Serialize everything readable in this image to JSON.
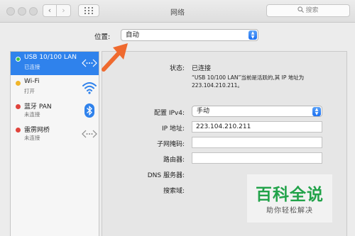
{
  "window": {
    "title": "网络",
    "search_placeholder": "搜索"
  },
  "location": {
    "label": "位置:",
    "value": "自动"
  },
  "services": [
    {
      "name": "USB 10/100 LAN",
      "status": "已连接",
      "dot_color": "#3cc04a",
      "icon": "ethernet-arrows-icon",
      "selected": true
    },
    {
      "name": "Wi-Fi",
      "status": "打开",
      "dot_color": "#f0b52a",
      "icon": "wifi-icon",
      "selected": false
    },
    {
      "name": "蓝牙 PAN",
      "status": "未连接",
      "dot_color": "#e0443c",
      "icon": "bluetooth-icon",
      "selected": false
    },
    {
      "name": "雷雳网桥",
      "status": "未连接",
      "dot_color": "#e0443c",
      "icon": "thunderbolt-arrows-icon",
      "selected": false
    }
  ],
  "detail": {
    "status_label": "状态:",
    "status_value": "已连接",
    "status_description": "“USB 10/100 LAN”当前是活跃的,其 IP 地址为 223.104.210.211。",
    "configure_label": "配置 IPv4:",
    "configure_value": "手动",
    "ip_label": "IP 地址:",
    "ip_value": "223.104.210.211",
    "subnet_label": "子网掩码:",
    "subnet_value": "",
    "router_label": "路由器:",
    "router_value": "",
    "dns_label": "DNS 服务器:",
    "search_domain_label": "搜索域:"
  },
  "watermark": {
    "title": "百科全说",
    "subtitle": "助你轻松解决"
  },
  "colors": {
    "accent": "#2f82ec",
    "annotation_arrow": "#ef6a2f"
  }
}
